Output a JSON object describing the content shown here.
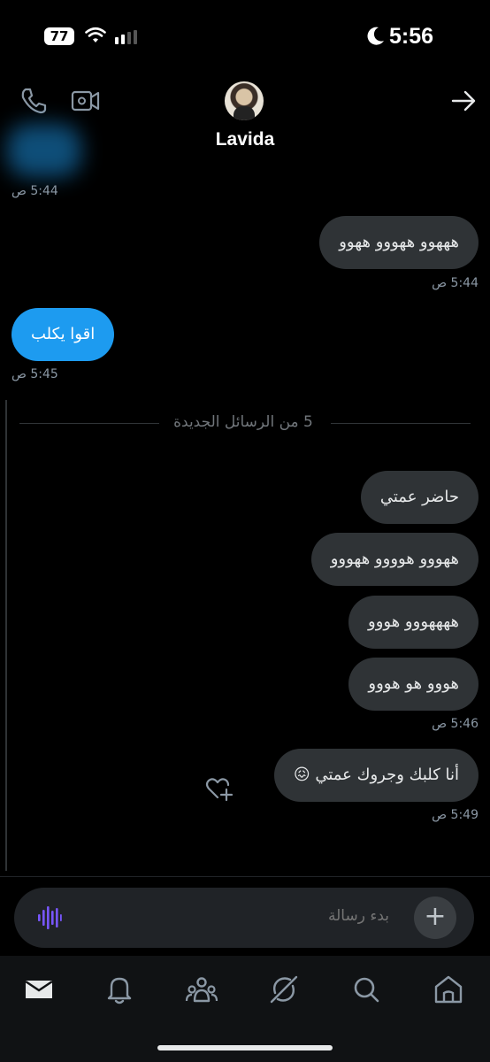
{
  "status_bar": {
    "time": "5:56",
    "battery": "77"
  },
  "header": {
    "contact_name": "Lavida"
  },
  "messages": [
    {
      "id": "m0",
      "time": "5:44 ص"
    },
    {
      "id": "m1",
      "text": "هههوو ههووو ههوو",
      "time": "5:44 ص"
    },
    {
      "id": "m2",
      "text": "اقوا يكلب",
      "time": "5:45 ص"
    },
    {
      "id": "m3",
      "text": "حاضر عمتي"
    },
    {
      "id": "m4",
      "text": "ههووو هوووو ههووو"
    },
    {
      "id": "m5",
      "text": "ههههووو هووو"
    },
    {
      "id": "m6",
      "text": "هووو هو هووو",
      "time": "5:46 ص"
    },
    {
      "id": "m7",
      "text": "أنا كلبك وجروك عمتي 😖",
      "time": "5:49 ص"
    }
  ],
  "new_messages_separator": "5 من الرسائل الجديدة",
  "composer": {
    "placeholder": "بدء رسالة",
    "plus_label": "+"
  },
  "colors": {
    "accent": "#1d9bf0",
    "bubble_mine": "#2f3336",
    "background": "#000000",
    "voice_accent": "#7856ff"
  },
  "tabs": [
    {
      "icon": "mail-icon",
      "active": true
    },
    {
      "icon": "bell-icon",
      "active": false
    },
    {
      "icon": "communities-icon",
      "active": false
    },
    {
      "icon": "grok-icon",
      "active": false
    },
    {
      "icon": "search-icon",
      "active": false
    },
    {
      "icon": "home-icon",
      "active": false
    }
  ]
}
